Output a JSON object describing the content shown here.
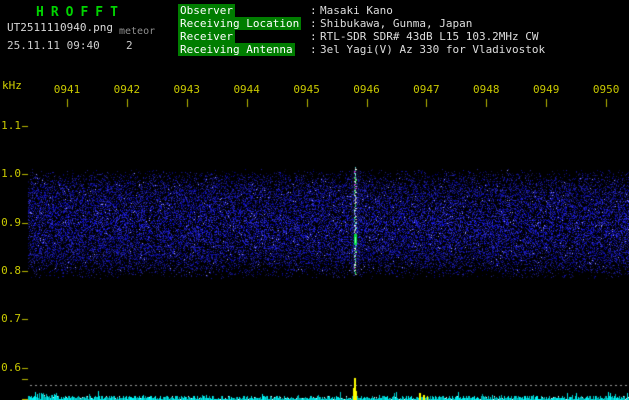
{
  "colors": {
    "background": "#000000",
    "title_green": "#00d400",
    "info_label_bg": "#007d00",
    "info_text": "#dddddd",
    "axis_yellow": "#c8c800",
    "noise_blue": "#2222cc",
    "baseline_cyan": "#00dddd",
    "event_yellow": "#ffff00"
  },
  "header": {
    "title": "HROFFT",
    "filename": "UT2511110940.png",
    "file_note": "meteor",
    "datetime": "25.11.11 09:40",
    "counter": "2"
  },
  "info": {
    "separator": ":",
    "rows": [
      {
        "label": "Observer",
        "value": "Masaki Kano"
      },
      {
        "label": "Receiving Location",
        "value": "Shibukawa, Gunma, Japan"
      },
      {
        "label": "Receiver",
        "value": "RTL-SDR SDR# 43dB L15 103.2MHz CW"
      },
      {
        "label": "Receiving Antenna",
        "value": "3el Yagi(V) Az 330 for Vladivostok"
      }
    ]
  },
  "chart_data": {
    "type": "heatmap",
    "title": "",
    "ylabel": "kHz",
    "y_tick_labels": [
      "1.1",
      "1.0",
      "0.9",
      "0.8",
      "0.7",
      "0.6"
    ],
    "y_range_khz": [
      0.55,
      1.15
    ],
    "x_tick_labels": [
      "0941",
      "0942",
      "0943",
      "0944",
      "0945",
      "0946",
      "0947",
      "0948",
      "0949",
      "0950"
    ],
    "grid": false,
    "noise_band_khz": [
      0.8,
      1.0
    ],
    "events": [
      {
        "name": "meteor-echo",
        "between_ticks": [
          "0945",
          "0946"
        ],
        "x_frac": 0.545,
        "freq_span_khz": [
          0.8,
          1.0
        ],
        "colors": [
          "white",
          "green",
          "magenta"
        ]
      }
    ],
    "bottom_strip": {
      "baseline_color": "#00dddd",
      "dotted_line_color": "#9a9a9a",
      "marks": [
        {
          "x_frac": 0.545,
          "color": "#ffff00",
          "size": "large"
        },
        {
          "x_frac": 0.652,
          "color": "#ffff00",
          "size": "small"
        }
      ]
    }
  }
}
